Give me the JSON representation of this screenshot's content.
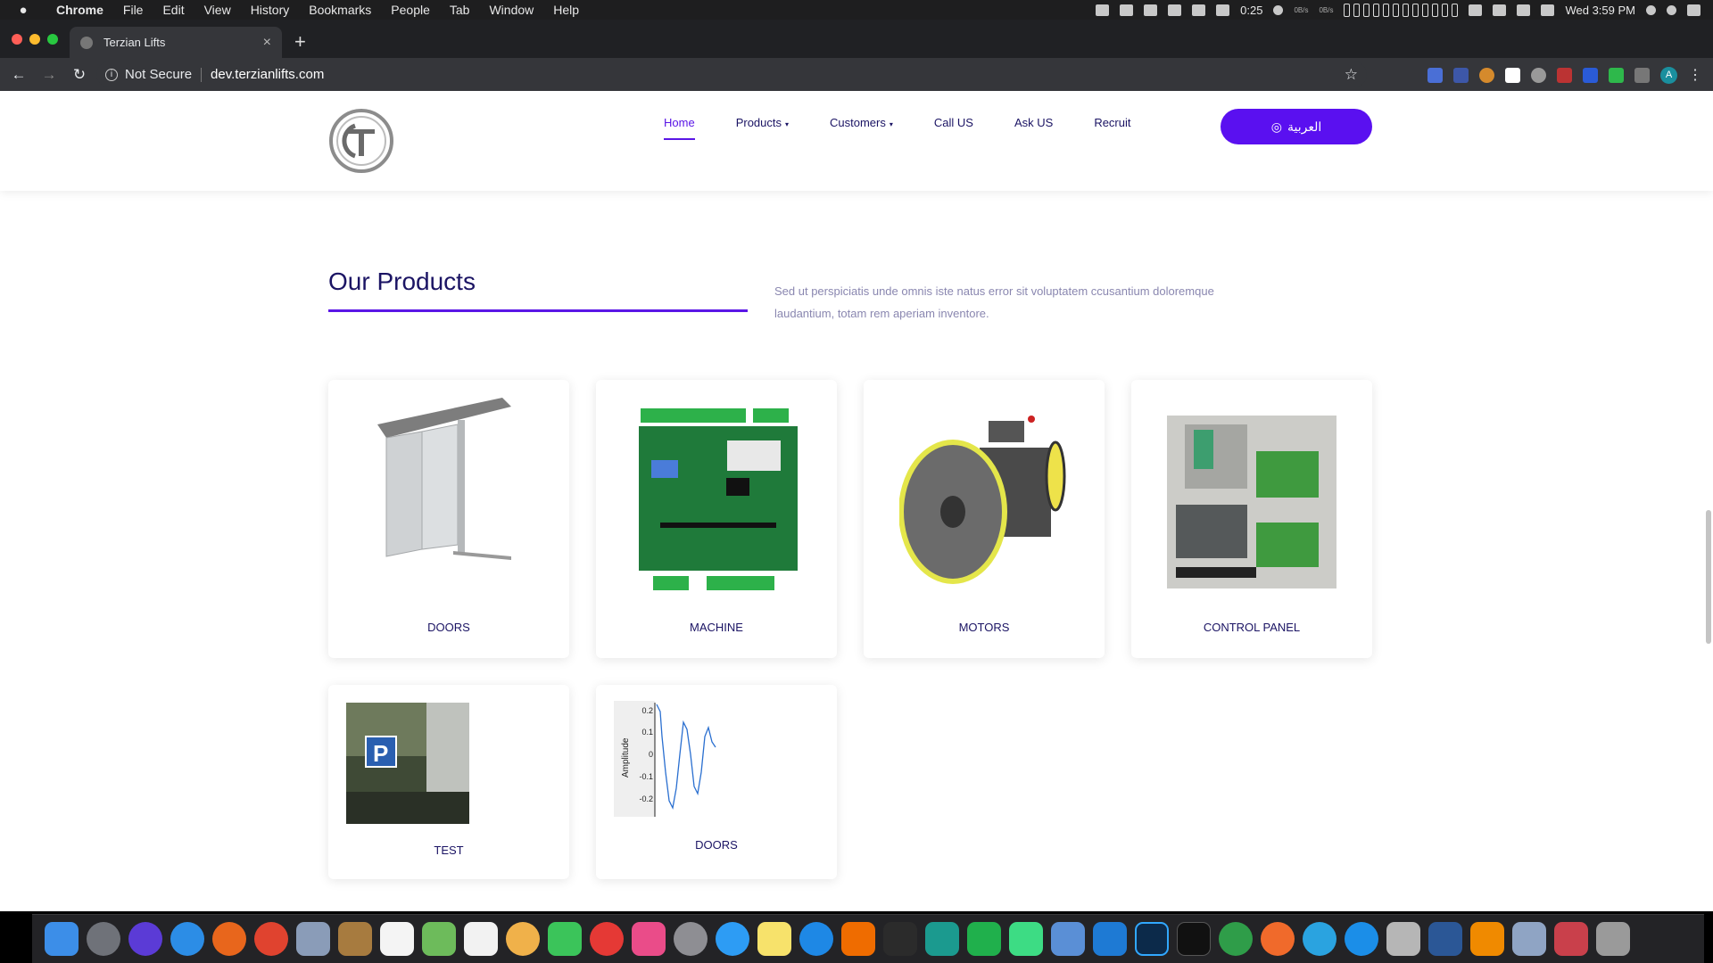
{
  "menubar": {
    "apple": "",
    "app_name": "Chrome",
    "items": [
      "File",
      "Edit",
      "View",
      "History",
      "Bookmarks",
      "People",
      "Tab",
      "Window",
      "Help"
    ],
    "timer": "0:25",
    "net_up": "0B/s",
    "net_down": "0B/s",
    "clock": "Wed 3:59 PM"
  },
  "browser": {
    "tab_title": "Terzian Lifts",
    "tab_close": "×",
    "new_tab": "+",
    "back": "←",
    "forward": "→",
    "reload": "↻",
    "security": "Not Secure",
    "url": "dev.terzianlifts.com",
    "star": "☆",
    "profile_initial": "A",
    "more": "⋮"
  },
  "site": {
    "logo_text": "T",
    "nav": [
      {
        "label": "Home",
        "active": true
      },
      {
        "label": "Products",
        "caret": "▾"
      },
      {
        "label": "Customers",
        "caret": "▾"
      },
      {
        "label": "Call US"
      },
      {
        "label": "Ask US"
      },
      {
        "label": "Recruit"
      }
    ],
    "lang_button": "العربية",
    "section_title": "Our Products",
    "section_desc": "Sed ut perspiciatis unde omnis iste natus error sit voluptatem ccusantium doloremque laudantium, totam rem aperiam inventore.",
    "products": [
      {
        "label": "DOORS"
      },
      {
        "label": "MACHINE"
      },
      {
        "label": "MOTORS"
      },
      {
        "label": "CONTROL PANEL"
      },
      {
        "label": "TEST"
      },
      {
        "label": "DOORS"
      }
    ],
    "plot": {
      "ylabel": "Amplitude",
      "ticks": [
        "0.2",
        "0.1",
        "0",
        "-0.1",
        "-0.2"
      ]
    }
  },
  "colors": {
    "accent": "#5a16e6",
    "navy": "#1b1464",
    "lang_button": "#5a10f0"
  }
}
